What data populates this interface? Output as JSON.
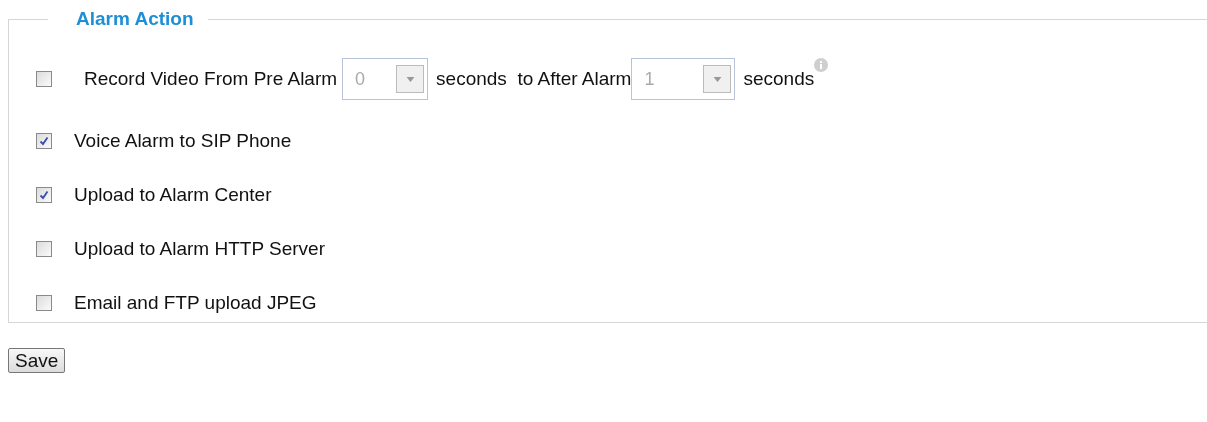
{
  "section": {
    "title": "Alarm Action"
  },
  "actions": [
    {
      "kind": "record",
      "checked": false,
      "label": "Record Video From Pre Alarm",
      "pre_select": {
        "value": "0",
        "disabled": true
      },
      "middle": "seconds  to After Alarm",
      "post_select": {
        "value": "1",
        "disabled": true
      },
      "unit": "seconds"
    },
    {
      "kind": "plain",
      "checked": true,
      "label": "Voice Alarm to SIP Phone"
    },
    {
      "kind": "plain",
      "checked": true,
      "label": "Upload to Alarm Center"
    },
    {
      "kind": "plain",
      "checked": false,
      "label": "Upload to Alarm HTTP Server"
    },
    {
      "kind": "plain",
      "checked": false,
      "label": "Email and FTP upload JPEG"
    }
  ],
  "buttons": [
    "Save"
  ]
}
